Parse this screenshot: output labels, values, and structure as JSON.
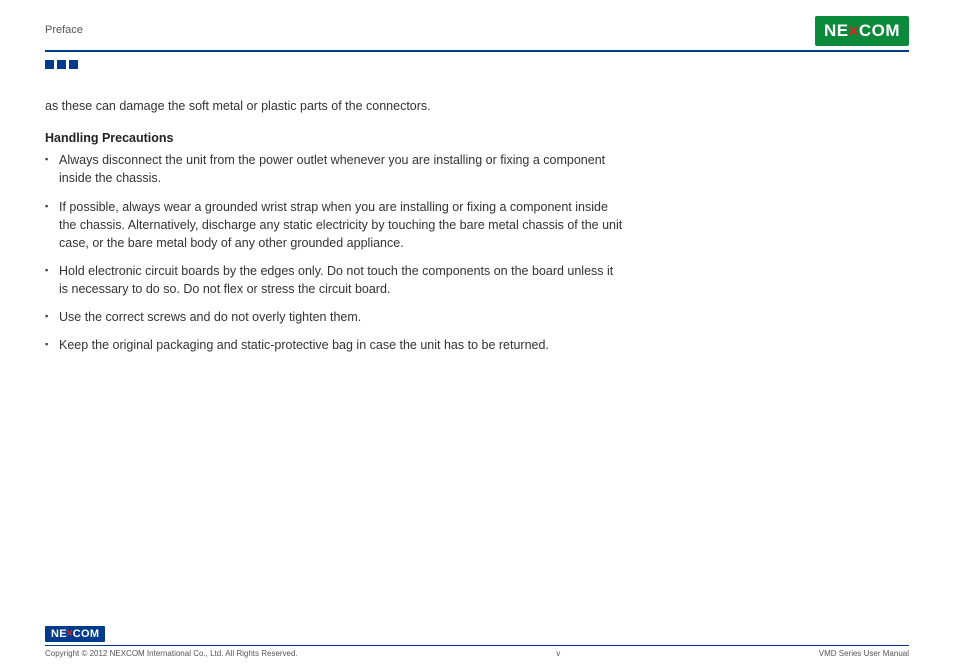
{
  "header": {
    "section": "Preface",
    "brand": {
      "left": "NE",
      "x": "✕",
      "right": "COM"
    }
  },
  "body": {
    "intro": "as these can damage the soft metal or plastic parts of the connectors.",
    "subhead": "Handling Precautions",
    "bullets": [
      "Always disconnect the unit from the power outlet whenever you are installing or fixing a component inside the chassis.",
      "If possible, always wear a grounded wrist strap when you are installing or fixing a component inside the chassis. Alternatively, discharge any static electricity by touching the bare metal chassis of the unit case, or the bare metal body of any other grounded appliance.",
      "Hold electronic circuit boards by the edges only. Do not touch the components on the board unless it is necessary to do so. Do not flex or stress the circuit board.",
      "Use the correct screws and do not overly tighten them.",
      "Keep the original packaging and static-protective bag in case the unit has to be returned."
    ]
  },
  "footer": {
    "brand": {
      "left": "NE",
      "x": "✕",
      "right": "COM"
    },
    "copyright": "Copyright © 2012 NEXCOM International Co., Ltd. All Rights Reserved.",
    "page": "v",
    "manual": "VMD Series User Manual"
  }
}
